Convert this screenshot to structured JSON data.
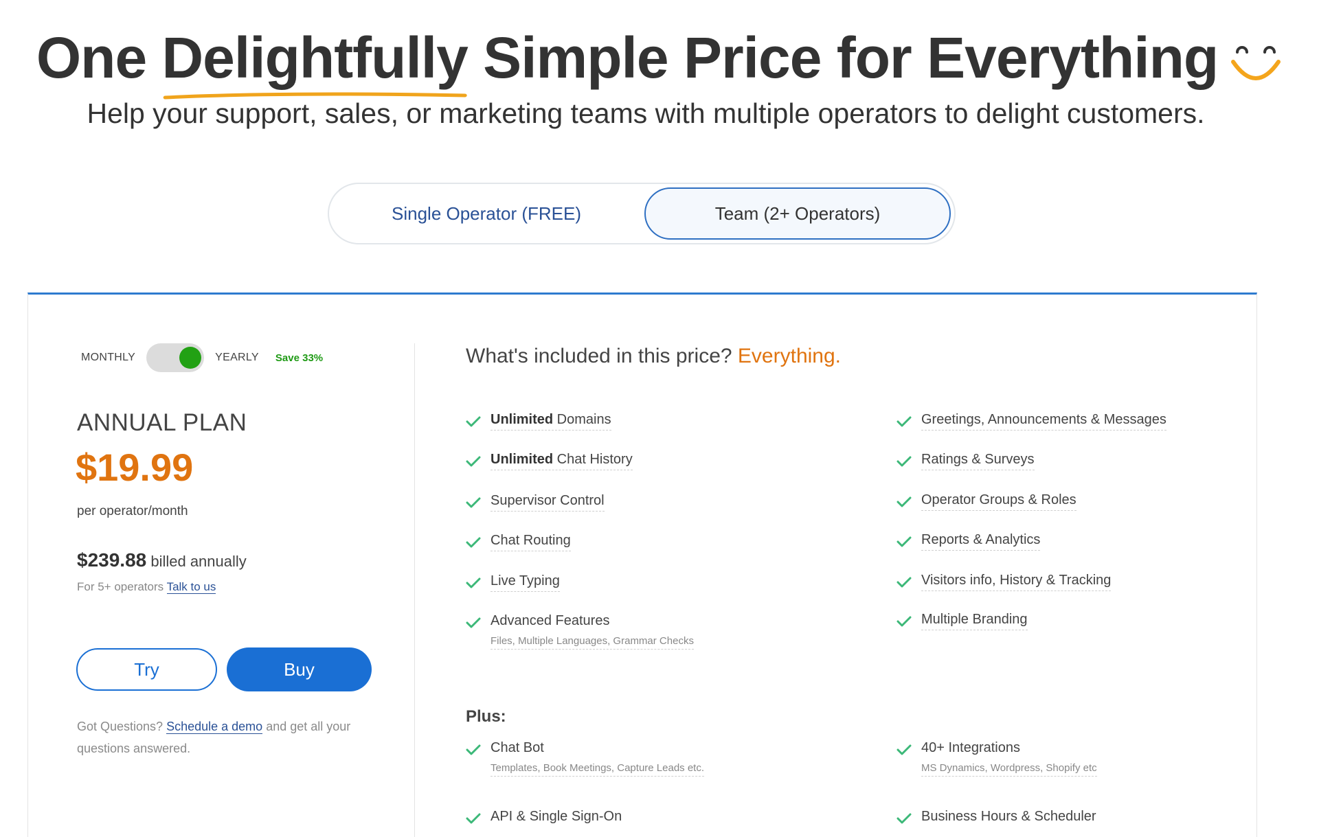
{
  "hero": {
    "title_before": "One ",
    "title_underlined": "Delightfully",
    "title_after": " Simple Price for Everything",
    "subtitle": "Help your support, sales, or marketing teams with multiple operators to delight customers."
  },
  "plan_tabs": [
    {
      "label": "Single Operator (FREE)",
      "selected": false
    },
    {
      "label": "Team (2+ Operators)",
      "selected": true
    }
  ],
  "billing": {
    "monthly_label": "MONTHLY",
    "yearly_label": "YEARLY",
    "save_label": "Save 33%",
    "yearly_selected": true
  },
  "plan": {
    "name": "ANNUAL PLAN",
    "price": "$19.99",
    "per": "per operator/month",
    "billed_amount": "$239.88",
    "billed_text": " billed annually",
    "five_plus_text": "For 5+ operators ",
    "five_plus_link": "Talk to us",
    "try_label": "Try",
    "buy_label": "Buy",
    "questions_prefix": "Got Questions? ",
    "questions_link": "Schedule a demo",
    "questions_suffix": " and get all your questions answered."
  },
  "included": {
    "title": "What's included in this price? ",
    "accent": "Everything."
  },
  "features_left": [
    {
      "bold": "Unlimited",
      "text": " Domains"
    },
    {
      "bold": "Unlimited",
      "text": " Chat History"
    },
    {
      "bold": "",
      "text": "Supervisor Control"
    },
    {
      "bold": "",
      "text": "Chat Routing"
    },
    {
      "bold": "",
      "text": "Live Typing"
    },
    {
      "bold": "",
      "text": "Advanced Features",
      "sub": "Files, Multiple Languages, Grammar Checks"
    }
  ],
  "features_right": [
    {
      "text": "Greetings, Announcements & Messages"
    },
    {
      "text": "Ratings & Surveys"
    },
    {
      "text": "Operator Groups & Roles"
    },
    {
      "text": "Reports & Analytics"
    },
    {
      "text": "Visitors info, History & Tracking"
    },
    {
      "text": "Multiple Branding"
    }
  ],
  "plus": {
    "title": "Plus:",
    "items": [
      {
        "text": "Chat Bot",
        "sub": "Templates, Book Meetings, Capture Leads etc."
      },
      {
        "text": "40+ Integrations",
        "sub": "MS Dynamics, Wordpress, Shopify etc"
      },
      {
        "text": "API & Single Sign-On"
      },
      {
        "text": "Business Hours & Scheduler"
      }
    ]
  },
  "colors": {
    "accent_orange": "#e07410",
    "primary_blue": "#1a6fd4",
    "check_green": "#3cb878",
    "toggle_green": "#22a114"
  },
  "icons": {
    "smile": "smile-icon",
    "check": "check-icon"
  }
}
